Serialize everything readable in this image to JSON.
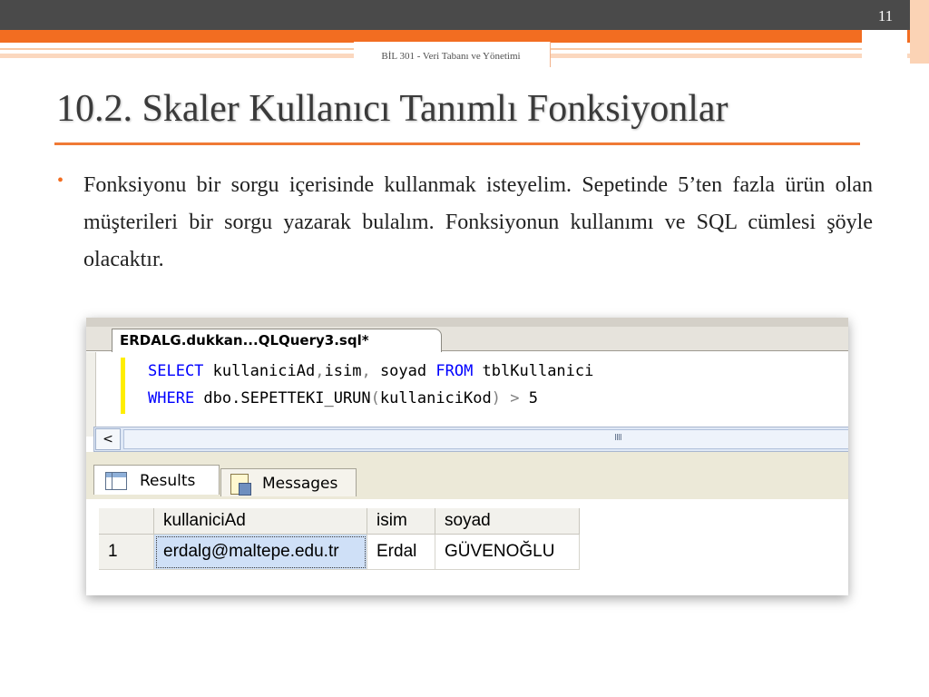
{
  "slide": {
    "number": "11",
    "subtitle": "BİL 301 - Veri Tabanı ve Yönetimi",
    "title": "10.2. Skaler Kullanıcı Tanımlı Fonksiyonlar",
    "bullet": "Fonksiyonu bir sorgu içerisinde kullanmak isteyelim. Sepetinde 5’ten fazla ürün olan müşterileri bir sorgu yazarak bulalım. Fonksiyonun kullanımı ve SQL cümlesi şöyle olacaktır."
  },
  "editor": {
    "tab_title": "ERDALG.dukkan...QLQuery3.sql*",
    "line1": {
      "kw1": "SELECT",
      "rest": " kullaniciAd",
      "comma1": ",",
      "isim": "isim",
      "comma2": ",",
      "soyad": " soyad ",
      "kw2": "FROM",
      "table": " tblKullanici"
    },
    "line2": {
      "kw1": "WHERE",
      "func": " dbo.SEPETTEKI_URUN",
      "open": "(",
      "arg": "kullaniciKod",
      "close": ")",
      "op": " > ",
      "num": "5"
    },
    "scroll_left": "<",
    "scroll_grip": "IIII"
  },
  "results": {
    "tabs": {
      "results": "Results",
      "messages": "Messages"
    },
    "columns": [
      "kullaniciAd",
      "isim",
      "soyad"
    ],
    "rows": [
      {
        "num": "1",
        "kullaniciAd": "erdalg@maltepe.edu.tr",
        "isim": "Erdal",
        "soyad": "GÜVENOĞLU"
      }
    ]
  },
  "colors": {
    "accent": "#f26d21",
    "topbar": "#4a4a4a",
    "sql_keyword": "#0000ff"
  }
}
